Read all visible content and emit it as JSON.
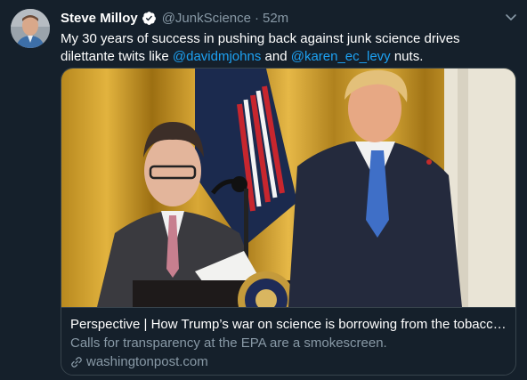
{
  "tweet": {
    "author_name": "Steve Milloy",
    "handle": "@JunkScience",
    "separator": "·",
    "time": "52m",
    "text_part1": "My 30 years of success in pushing back against junk science drives dilettante twits like ",
    "mention1": "@davidmjohns",
    "text_part2": " and ",
    "mention2": "@karen_ec_levy",
    "text_part3": " nuts."
  },
  "card": {
    "title": "Perspective | How Trump’s war on science is borrowing from the tobacco i...",
    "description": "Calls for transparency at the EPA are a smokescreen.",
    "domain": "washingtonpost.com"
  },
  "icons": {
    "verified": "verified-badge-icon",
    "menu": "chevron-down-icon",
    "link": "link-icon"
  },
  "colors": {
    "background": "#15202b",
    "accent": "#1da1f2",
    "muted": "#8899a6",
    "border": "#38444d"
  }
}
